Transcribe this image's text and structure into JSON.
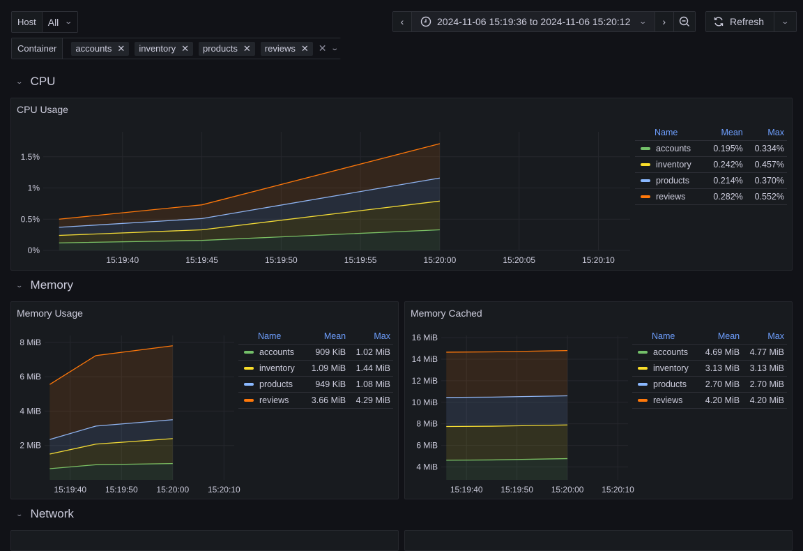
{
  "variables": {
    "host": {
      "label": "Host",
      "value": "All"
    },
    "container": {
      "label": "Container",
      "selected": [
        "accounts",
        "inventory",
        "products",
        "reviews"
      ]
    }
  },
  "time_picker": {
    "range_text": "2024-11-06 15:19:36 to 2024-11-06 15:20:12",
    "refresh_label": "Refresh"
  },
  "sections": {
    "cpu": "CPU",
    "memory": "Memory",
    "network": "Network"
  },
  "series_colors": {
    "accounts": "#73bf69",
    "inventory": "#fade2a",
    "products": "#8ab8ff",
    "reviews": "#ff780a"
  },
  "legend_headers": {
    "name": "Name",
    "mean": "Mean",
    "max": "Max"
  },
  "panels": {
    "cpu_usage": {
      "title": "CPU Usage",
      "legend": [
        {
          "name": "accounts",
          "mean": "0.195%",
          "max": "0.334%"
        },
        {
          "name": "inventory",
          "mean": "0.242%",
          "max": "0.457%"
        },
        {
          "name": "products",
          "mean": "0.214%",
          "max": "0.370%"
        },
        {
          "name": "reviews",
          "mean": "0.282%",
          "max": "0.552%"
        }
      ]
    },
    "memory_usage": {
      "title": "Memory Usage",
      "legend": [
        {
          "name": "accounts",
          "mean": "909 KiB",
          "max": "1.02 MiB"
        },
        {
          "name": "inventory",
          "mean": "1.09 MiB",
          "max": "1.44 MiB"
        },
        {
          "name": "products",
          "mean": "949 KiB",
          "max": "1.08 MiB"
        },
        {
          "name": "reviews",
          "mean": "3.66 MiB",
          "max": "4.29 MiB"
        }
      ]
    },
    "memory_cached": {
      "title": "Memory Cached",
      "legend": [
        {
          "name": "accounts",
          "mean": "4.69 MiB",
          "max": "4.77 MiB"
        },
        {
          "name": "inventory",
          "mean": "3.13 MiB",
          "max": "3.13 MiB"
        },
        {
          "name": "products",
          "mean": "2.70 MiB",
          "max": "2.70 MiB"
        },
        {
          "name": "reviews",
          "mean": "4.20 MiB",
          "max": "4.20 MiB"
        }
      ]
    }
  },
  "chart_data": [
    {
      "id": "cpu",
      "type": "area",
      "stacked": true,
      "title": "CPU Usage",
      "x_range_seconds": [
        -1,
        36
      ],
      "x": [
        0,
        9,
        24
      ],
      "x_ticks": [
        {
          "t": 4,
          "label": "15:19:40"
        },
        {
          "t": 9,
          "label": "15:19:45"
        },
        {
          "t": 14,
          "label": "15:19:50"
        },
        {
          "t": 19,
          "label": "15:19:55"
        },
        {
          "t": 24,
          "label": "15:20:00"
        },
        {
          "t": 29,
          "label": "15:20:05"
        },
        {
          "t": 34,
          "label": "15:20:10"
        }
      ],
      "y_ticks": [
        {
          "v": 0,
          "label": "0%"
        },
        {
          "v": 0.5,
          "label": "0.5%"
        },
        {
          "v": 1,
          "label": "1%"
        },
        {
          "v": 1.5,
          "label": "1.5%"
        }
      ],
      "ylim": [
        0,
        1.9
      ],
      "series": [
        {
          "name": "accounts",
          "values": [
            0.12,
            0.16,
            0.33
          ]
        },
        {
          "name": "inventory",
          "values": [
            0.12,
            0.17,
            0.46
          ]
        },
        {
          "name": "products",
          "values": [
            0.13,
            0.18,
            0.37
          ]
        },
        {
          "name": "reviews",
          "values": [
            0.13,
            0.22,
            0.55
          ]
        }
      ]
    },
    {
      "id": "memusage",
      "type": "area",
      "stacked": true,
      "title": "Memory Usage",
      "x_range_seconds": [
        -1,
        36
      ],
      "x": [
        0,
        9,
        24
      ],
      "x_ticks": [
        {
          "t": 4,
          "label": "15:19:40"
        },
        {
          "t": 14,
          "label": "15:19:50"
        },
        {
          "t": 24,
          "label": "15:20:00"
        },
        {
          "t": 34,
          "label": "15:20:10"
        }
      ],
      "y_ticks": [
        {
          "v": 2,
          "label": "2 MiB"
        },
        {
          "v": 4,
          "label": "4 MiB"
        },
        {
          "v": 6,
          "label": "6 MiB"
        },
        {
          "v": 8,
          "label": "8 MiB"
        }
      ],
      "ylim": [
        0,
        8.4
      ],
      "series": [
        {
          "name": "accounts",
          "values": [
            0.65,
            0.88,
            0.95
          ]
        },
        {
          "name": "inventory",
          "values": [
            0.85,
            1.2,
            1.45
          ]
        },
        {
          "name": "products",
          "values": [
            0.85,
            1.05,
            1.1
          ]
        },
        {
          "name": "reviews",
          "values": [
            3.2,
            4.1,
            4.3
          ]
        }
      ]
    },
    {
      "id": "memcached",
      "type": "area",
      "stacked": true,
      "title": "Memory Cached",
      "x_range_seconds": [
        -1,
        36
      ],
      "x": [
        0,
        9,
        24
      ],
      "x_ticks": [
        {
          "t": 4,
          "label": "15:19:40"
        },
        {
          "t": 14,
          "label": "15:19:50"
        },
        {
          "t": 24,
          "label": "15:20:00"
        },
        {
          "t": 34,
          "label": "15:20:10"
        }
      ],
      "y_ticks": [
        {
          "v": 4,
          "label": "4 MiB"
        },
        {
          "v": 6,
          "label": "6 MiB"
        },
        {
          "v": 8,
          "label": "8 MiB"
        },
        {
          "v": 10,
          "label": "10 MiB"
        },
        {
          "v": 12,
          "label": "12 MiB"
        },
        {
          "v": 14,
          "label": "14 MiB"
        },
        {
          "v": 16,
          "label": "16 MiB"
        }
      ],
      "ylim": [
        2.8,
        16.2
      ],
      "series": [
        {
          "name": "accounts",
          "values": [
            4.62,
            4.65,
            4.77
          ]
        },
        {
          "name": "inventory",
          "values": [
            3.13,
            3.13,
            3.13
          ]
        },
        {
          "name": "products",
          "values": [
            2.7,
            2.7,
            2.7
          ]
        },
        {
          "name": "reviews",
          "values": [
            4.2,
            4.2,
            4.2
          ]
        }
      ]
    }
  ]
}
